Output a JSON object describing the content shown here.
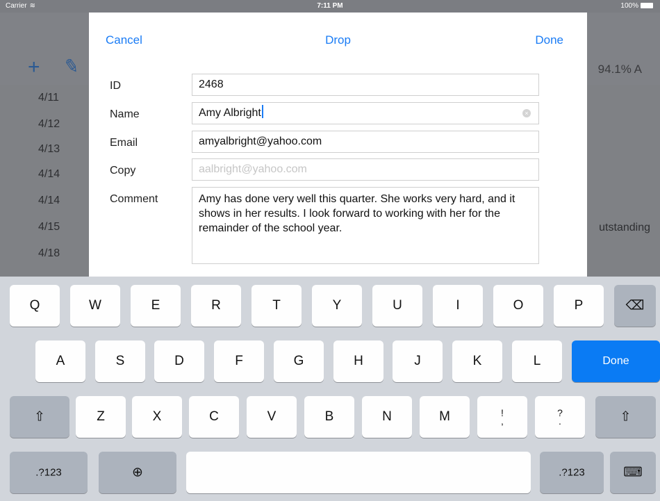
{
  "status_bar": {
    "carrier": "Carrier",
    "time": "7:11 PM",
    "battery": "100%"
  },
  "background": {
    "percent_label": "94.1% A",
    "dates": [
      "4/11",
      "4/12",
      "4/13",
      "4/14",
      "4/14",
      "4/15",
      "4/18"
    ],
    "outstanding_text": "utstanding"
  },
  "modal": {
    "cancel_label": "Cancel",
    "title": "Drop",
    "done_label": "Done",
    "fields": {
      "id": {
        "label": "ID",
        "value": "2468"
      },
      "name": {
        "label": "Name",
        "value": "Amy Albright"
      },
      "email": {
        "label": "Email",
        "value": "amyalbright@yahoo.com"
      },
      "copy": {
        "label": "Copy",
        "placeholder": "aalbright@yahoo.com"
      },
      "comment": {
        "label": "Comment",
        "value": "Amy has done very well this quarter. She works very hard, and it shows in her results. I look forward to working with her for the remainder of the school year."
      }
    }
  },
  "keyboard": {
    "row1": [
      "Q",
      "W",
      "E",
      "R",
      "T",
      "Y",
      "U",
      "I",
      "O",
      "P"
    ],
    "row2": [
      "A",
      "S",
      "D",
      "F",
      "G",
      "H",
      "J",
      "K",
      "L"
    ],
    "row3": [
      "Z",
      "X",
      "C",
      "V",
      "B",
      "N",
      "M"
    ],
    "done_label": "Done",
    "exclam_top": "!",
    "exclam_bottom": ",",
    "question_top": "?",
    "question_bottom": ".",
    "numbers_label": ".?123"
  }
}
